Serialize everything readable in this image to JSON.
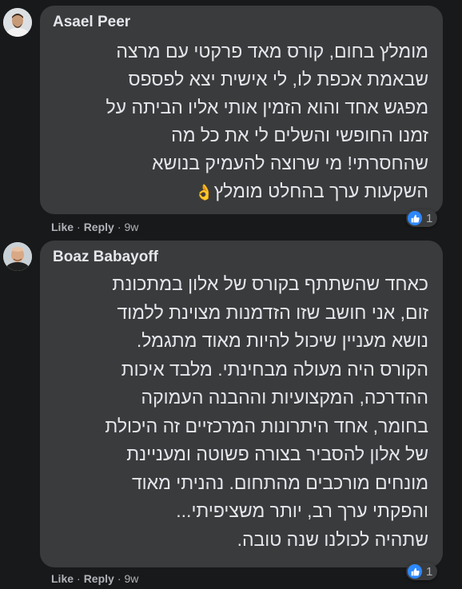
{
  "comments": [
    {
      "author": "Asael Peer",
      "lines": [
        "מומלץ בחום, קורס מאד פרקטי עם מרצה",
        "שבאמת אכפת לו, לי אישית יצא לפספס",
        "מפגש אחד והוא הזמין אותי אליו הביתה על",
        "זמנו החופשי והשלים לי את כל מה",
        "שהחסרתי! מי שרוצה להעמיק בנושא",
        "השקעות ערך בהחלט מומלץ"
      ],
      "emoji": "👌",
      "like_label": "Like",
      "reply_label": "Reply",
      "separator": "·",
      "time": "9w",
      "reaction_icon": "like-icon",
      "reaction_count": "1"
    },
    {
      "author": "Boaz Babayoff",
      "lines": [
        "כאחד שהשתתף בקורס של אלון במתכונת",
        "זום, אני חושב שזו הזדמנות מצוינת ללמוד",
        "נושא מעניין שיכול להיות מאוד מתגמל.",
        "הקורס היה מעולה מבחינתי. מלבד איכות",
        "ההדרכה, המקצועיות וההבנה העמוקה",
        "בחומר, אחד היתרונות המרכזיים זה היכולת",
        "של אלון להסביר בצורה פשוטה ומעניינת",
        "מונחים מורכבים מהתחום. נהניתי מאוד",
        "והפקתי ערך רב, יותר משציפיתי...",
        "שתהיה לכולנו שנה טובה."
      ],
      "like_label": "Like",
      "reply_label": "Reply",
      "separator": "·",
      "time": "9w",
      "reaction_icon": "like-icon",
      "reaction_count": "1"
    }
  ],
  "colors": {
    "background": "#18191a",
    "bubble": "#3a3b3c",
    "text": "#e4e6eb",
    "secondary_text": "#b0b3b8",
    "like_blue": "#2d88ff"
  }
}
